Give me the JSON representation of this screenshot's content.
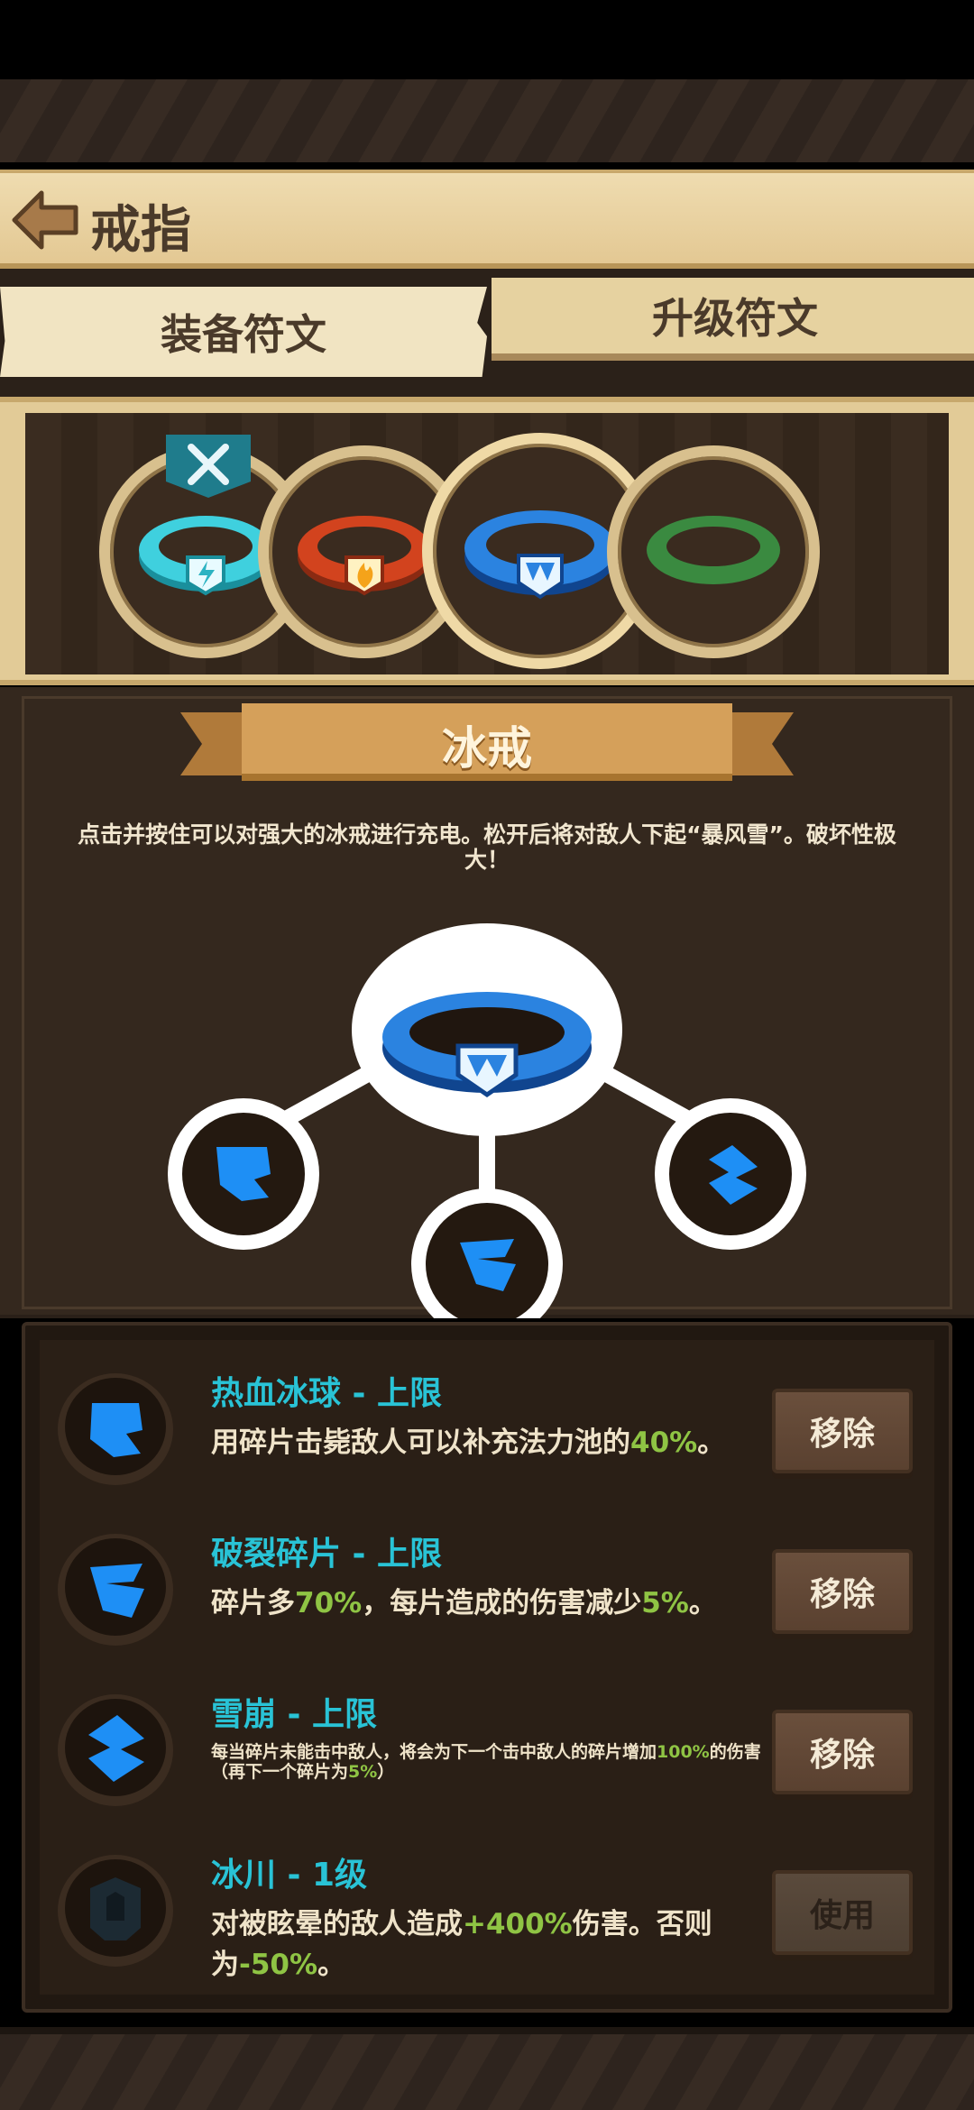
{
  "header": {
    "title": "戒指"
  },
  "tabs": [
    {
      "label": "装备符文"
    },
    {
      "label": "升级符文"
    }
  ],
  "rings": [
    {
      "name": "lightning-ring-icon",
      "color": "#22b8c8",
      "equipped": true
    },
    {
      "name": "fire-ring-icon",
      "color": "#d2431e",
      "equipped": false
    },
    {
      "name": "ice-ring-icon",
      "color": "#1f6fd1",
      "equipped": false,
      "selected": true
    },
    {
      "name": "green-ring-icon",
      "color": "#3a8a40",
      "equipped": false
    }
  ],
  "detail": {
    "ring_name": "冰戒",
    "description": "点击并按住可以对强大的冰戒进行充电。松开后将对敌人下起“暴风雪”。破坏性极大！"
  },
  "upgrades": [
    {
      "title": "热血冰球 - 上限",
      "desc_pre": "用碎片击毙敌人可以补充法力池的",
      "desc_hl": "40%",
      "desc_post": "。",
      "button": "移除",
      "icon": "bloody-iceball-icon"
    },
    {
      "title": "破裂碎片 - 上限",
      "desc_pre": "碎片多",
      "desc_hl": "70%",
      "desc_mid": "，每片造成的伤害减少",
      "desc_hl2": "5%",
      "desc_post": "。",
      "button": "移除",
      "icon": "shatter-shard-icon"
    },
    {
      "title": "雪崩 - 上限",
      "desc_pre": "每当碎片未能击中敌人，将会为下一个击中敌人的碎片增加",
      "desc_hl": "100%",
      "desc_mid": "的伤害（再下一个碎片为",
      "desc_hl2": "5%",
      "desc_post": "）",
      "button": "移除",
      "icon": "avalanche-icon"
    },
    {
      "title": "冰川 - 1级",
      "desc_pre": "对被眩晕的敌人造成",
      "desc_hl": "+400%",
      "desc_mid": "伤害。否则为",
      "desc_hl2": "-50%",
      "desc_post": "。",
      "button": "使用",
      "icon": "glacier-icon"
    }
  ],
  "colors": {
    "accent_cyan": "#29c3d6",
    "highlight_green": "#8fc444",
    "parchment": "#efdcb0",
    "dark_bg": "#2a1f16"
  }
}
